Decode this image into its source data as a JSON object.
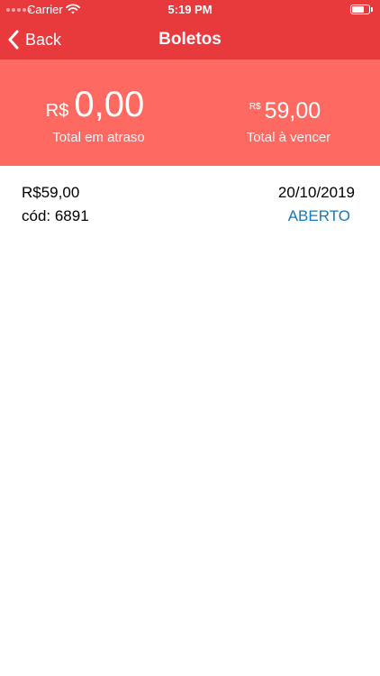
{
  "status_bar": {
    "carrier": "Carrier",
    "time": "5:19 PM",
    "icons": [
      "signal-dots-icon",
      "wifi-icon",
      "battery-icon"
    ]
  },
  "navbar": {
    "back_label": "Back",
    "title": "Boletos",
    "background_color": "#e83a3c"
  },
  "summary": {
    "background_color": "#fe6a61",
    "overdue": {
      "currency": "R$",
      "value": "0,00",
      "label": "Total em atraso"
    },
    "upcoming": {
      "currency": "R$",
      "value": "59,00",
      "label": "Total à vencer"
    }
  },
  "boletos": [
    {
      "amount": "R$59,00",
      "code": "cód: 6891",
      "due_date": "20/10/2019",
      "status": "ABERTO",
      "status_color": "#1a78b8"
    }
  ]
}
